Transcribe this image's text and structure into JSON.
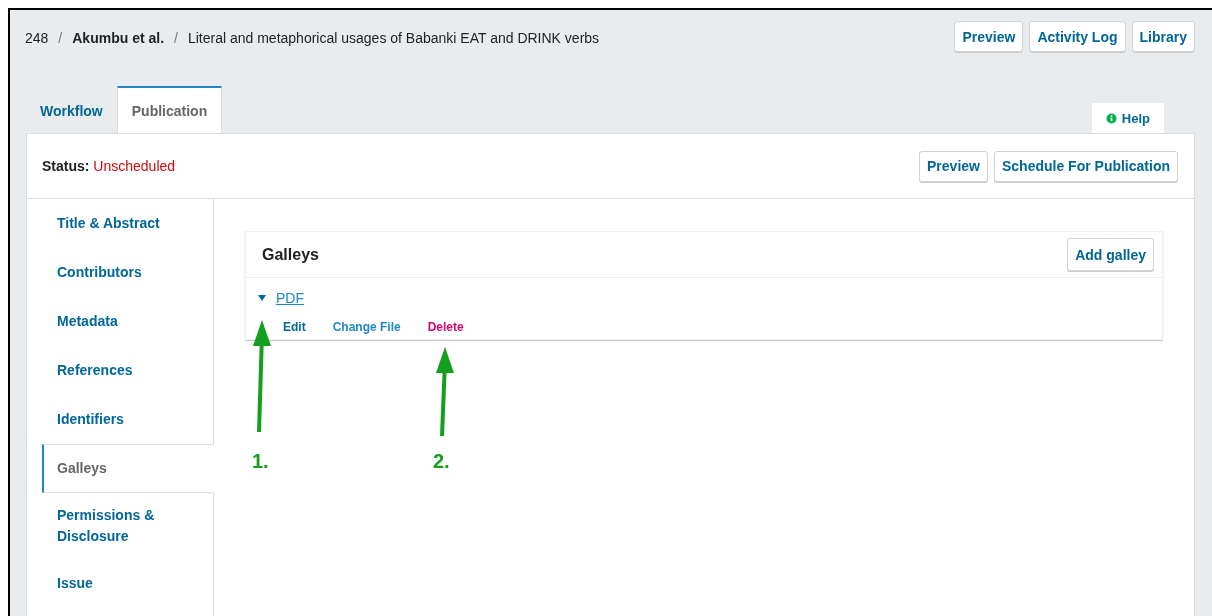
{
  "breadcrumb": {
    "id": "248",
    "separator": "/",
    "authors": "Akumbu et al.",
    "title": "Literal and metaphorical usages of Babanki EAT and DRINK verbs"
  },
  "header_buttons": [
    "Preview",
    "Activity Log",
    "Library"
  ],
  "tabs": [
    {
      "label": "Workflow",
      "selected": false
    },
    {
      "label": "Publication",
      "selected": true
    }
  ],
  "help": {
    "label": "Help"
  },
  "status": {
    "label": "Status:",
    "value": "Unscheduled"
  },
  "publication_buttons": [
    "Preview",
    "Schedule For Publication"
  ],
  "sidebar": {
    "items": [
      {
        "label": "Title & Abstract",
        "selected": false
      },
      {
        "label": "Contributors",
        "selected": false
      },
      {
        "label": "Metadata",
        "selected": false
      },
      {
        "label": "References",
        "selected": false
      },
      {
        "label": "Identifiers",
        "selected": false
      },
      {
        "label": "Galleys",
        "selected": true
      },
      {
        "label": "Permissions & Disclosure",
        "selected": false
      },
      {
        "label": "Issue",
        "selected": false
      }
    ]
  },
  "galleys": {
    "title": "Galleys",
    "add_button": "Add galley",
    "items": [
      {
        "label": "PDF",
        "expanded": true,
        "actions": [
          {
            "label": "Edit",
            "kind": "primary"
          },
          {
            "label": "Change File",
            "kind": "link"
          },
          {
            "label": "Delete",
            "kind": "danger"
          }
        ]
      }
    ]
  },
  "annotations": [
    {
      "label": "1."
    },
    {
      "label": "2."
    }
  ]
}
